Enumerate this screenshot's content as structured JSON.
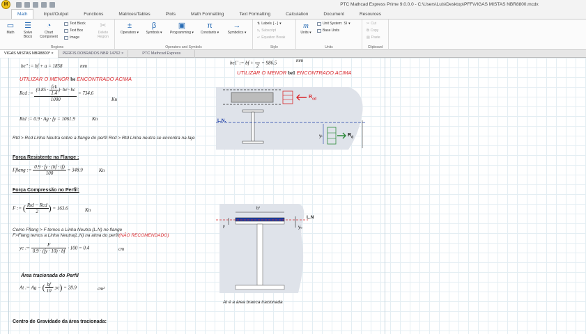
{
  "title_bar": {
    "text": "PTC Mathcad Express Prime 9.0.0.0 - C:\\Users\\Luis\\Desktop\\PFF\\VIGAS MISTAS NBR8800.mcdx"
  },
  "ribbon_tabs": [
    "Math",
    "Input/Output",
    "Functions",
    "Matrices/Tables",
    "Plots",
    "Math Formatting",
    "Text Formatting",
    "Calculation",
    "Document",
    "Resources"
  ],
  "ribbon": {
    "regions": {
      "label": "Regions",
      "math": "Math",
      "solve_block": "Solve Block",
      "chart_component": "Chart Component",
      "text_block": "Text Block",
      "text_box": "Text Box",
      "image": "Image",
      "delete_region": "Delete Region"
    },
    "operators_symbols": {
      "label": "Operators and Symbols",
      "operators": "Operators",
      "symbols": "Symbols",
      "programming": "Programming",
      "constants": "Constants",
      "symbolics": "Symbolics"
    },
    "style": {
      "label": "Style",
      "labels": "Labels",
      "labels_value": "[ - ]",
      "subscript": "Subscript",
      "equation_break": "Equation Break"
    },
    "units": {
      "label": "Units",
      "units": "Units",
      "unit_system": "Unit System:",
      "unit_system_value": "SI",
      "base_units": "Base Units"
    },
    "clipboard": {
      "label": "Clipboard",
      "cut": "Cut",
      "copy": "Copy",
      "paste": "Paste"
    }
  },
  "doc_tabs": [
    {
      "label": "VIGAS MISTAS NBR8800*",
      "active": true
    },
    {
      "label": "PERFIS DOBRADOS NBR 14762",
      "active": false
    },
    {
      "label": "PTC Mathcad Express",
      "active": false
    }
  ],
  "worksheet": {
    "be_formula": "be'' := bf + a = 1858",
    "be_unit": "mm",
    "use_lesser_1": "UTILIZAR O MENOR",
    "be_var": "be",
    "found_above_1": "ENCONTRADO ACIMA",
    "rcd_lhs": "Rcd :=",
    "rcd_num_inner_top": "fck",
    "rcd_num_inner_bottom": "1.4",
    "rcd_num_prefix": "0.85 ·",
    "rcd_num_suffix": "· be'· hc",
    "rcd_den": "1000",
    "rcd_result": "= 734.6",
    "rcd_unit": "Kn",
    "rtd_formula": "Rtd := 0.9 · Ag · fy = 1061.9",
    "rtd_unit": "Kn",
    "rtd_note": "Rtd > Rcd Linha Neutra sobre a flange do perfil   Rcd > Rtd Linha neutra se encontra na laje",
    "force_flange_title": "Força Resistente na Flange :",
    "fflang_lhs": "Fflang :=",
    "fflang_num": "0.9 · fy · (bf · tf)",
    "fflang_den": "100",
    "fflang_result": "= 348.9",
    "fflang_unit": "Kn",
    "force_comp_title": "Força Compressão no Perfil:",
    "f_lhs": "F :=",
    "f_num": "Rtd − Rcd",
    "f_den": "2",
    "f_result": "= 163.6",
    "f_unit": "Kn",
    "ln_note_1": "Como Fflang > F temos a Linha Neutra (L.N) no flange",
    "ln_note_2": "F>Flang temos a Linha Neutra(L.N) na alma do perfil",
    "ln_note_not_recommended": "(NÃO RECOMENDADO)",
    "yc_lhs": "yc :=",
    "yc_num": "F",
    "yc_den": "0.9 · (fy · 10) · bf",
    "yc_result": "· 100 = 0.4",
    "yc_unit": "cm",
    "area_title": "Área tracionada do Perfil",
    "at_lhs": "At := Ag −",
    "at_frac_num": "bf",
    "at_frac_den": "10",
    "at_suffix": "· yc",
    "at_result": "= 28.9",
    "at_unit": "cm²",
    "centroid_title": "Centro de Gravidade da área tracionada:",
    "be1_formula": "be1' := bf +",
    "be1_den": "2",
    "be1_result": "= 986.5",
    "be1_unit": "mm",
    "use_lesser_2": "UTILIZAR O MENOR",
    "be1_var": "be1",
    "found_above_2": "ENCONTRADO ACIMA",
    "fig1_ln": "L.N.",
    "fig1_rcd": "R",
    "fig1_rcd_sub": "cd",
    "fig1_rd": "R",
    "fig1_rd_sub": "d",
    "fig1_yt": "yₜ",
    "fig2_bf": "bⁱ",
    "fig2_ln": "L.N",
    "fig2_tf": "tⁱ",
    "fig2_yc": "yₑ",
    "fig2_caption": "At é a área branca tracionada"
  },
  "colors": {
    "accent": "#2a6db5",
    "red_text": "#d9262a",
    "beam_blue": "#1f3fa8",
    "grid": "#e4eef3"
  }
}
